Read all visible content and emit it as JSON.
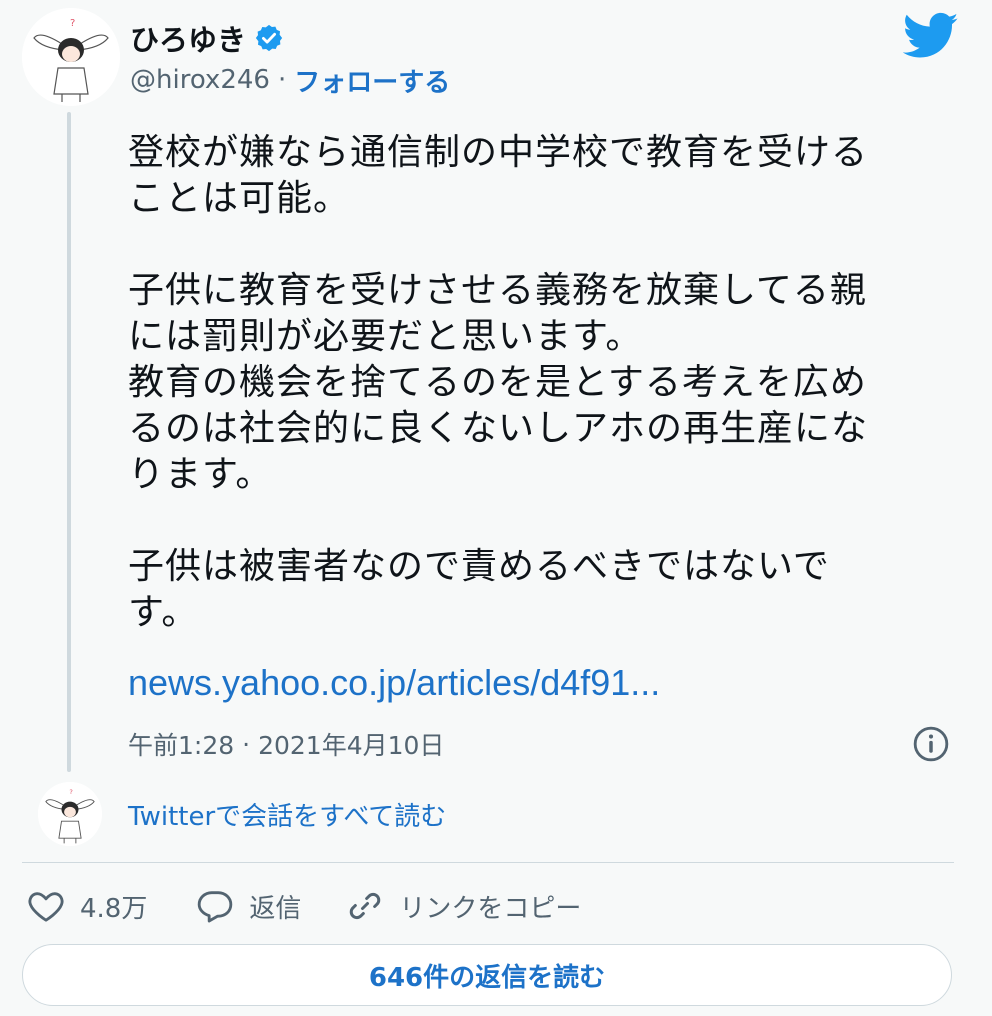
{
  "author": {
    "display_name": "ひろゆき",
    "handle": "@hirox246",
    "separator": "·",
    "follow_label": "フォローする"
  },
  "tweet": {
    "text": "登校が嫌なら通信制の中学校で教育を受ける\nことは可能。\n\n子供に教育を受けさせる義務を放棄してる親\nには罰則が必要だと思います。\n教育の機会を捨てるのを是とする考えを広め\nるのは社会的に良くないしアホの再生産にな\nります。\n\n子供は被害者なので責めるべきではないで\nす。",
    "link": "news.yahoo.co.jp/articles/d4f91...",
    "time": "午前1:28",
    "separator": "·",
    "date": "2021年4月10日"
  },
  "conversation_link": "Twitterで会話をすべて読む",
  "actions": {
    "like_count": "4.8万",
    "reply_label": "返信",
    "copy_link_label": "リンクをコピー"
  },
  "read_replies_label": "646件の返信を読む",
  "colors": {
    "accent": "#1d72c8",
    "twitter_blue": "#1d9bf0",
    "muted_text": "#536471",
    "background": "#f7f9f9",
    "border": "#cfd9de"
  },
  "icons": {
    "verified": "verified-badge-icon",
    "logo": "twitter-bird-icon",
    "info": "info-icon",
    "like": "heart-icon",
    "reply": "speech-bubble-icon",
    "copy_link": "chain-link-icon"
  }
}
